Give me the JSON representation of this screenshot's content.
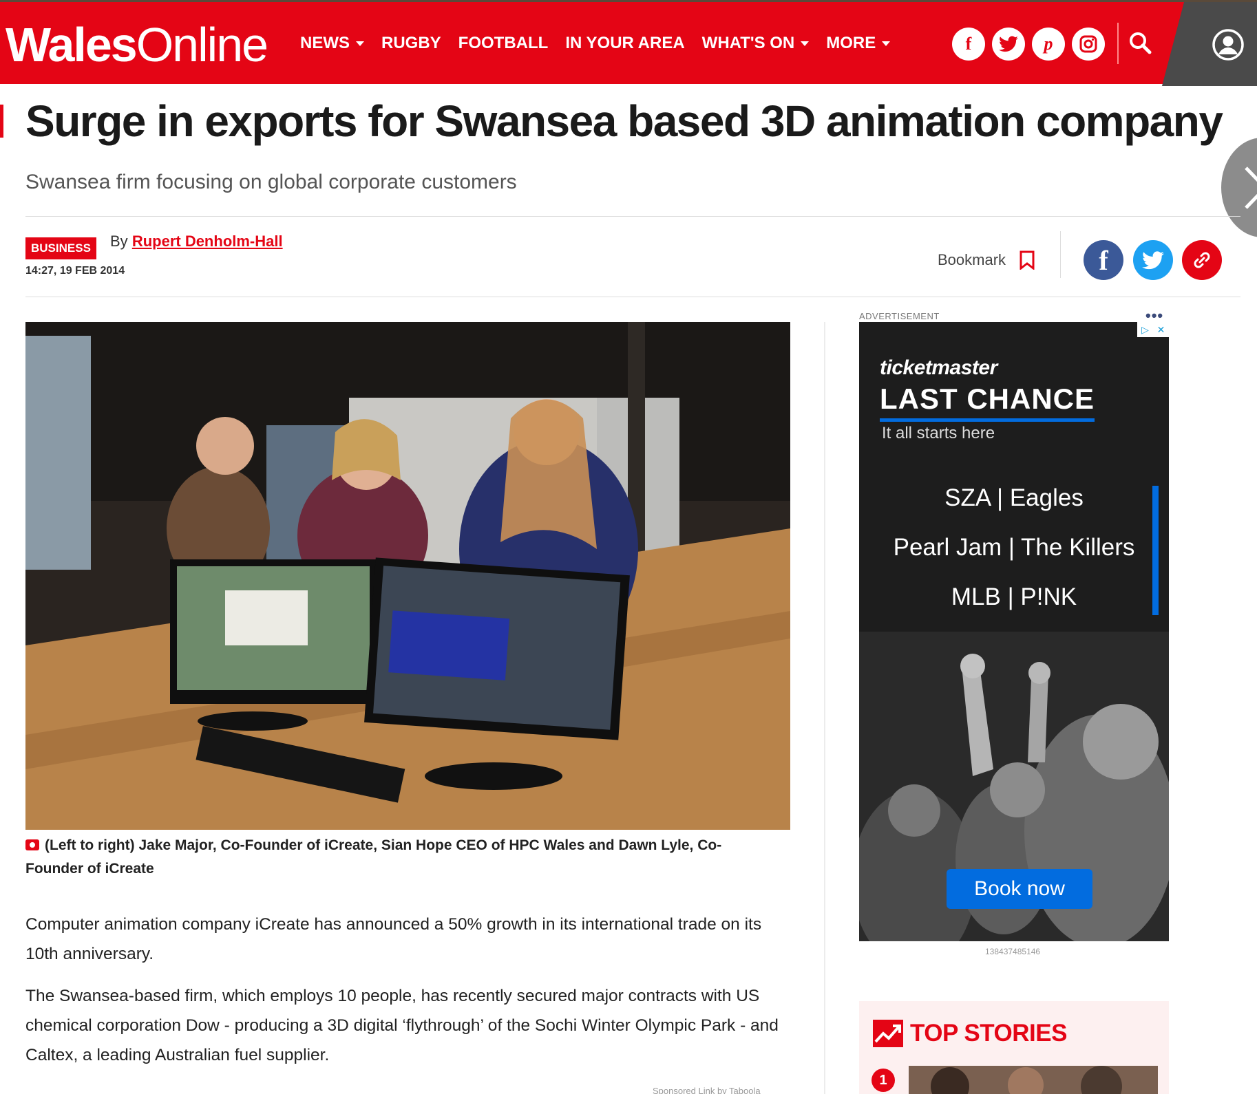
{
  "header": {
    "logo_bold": "Wales",
    "logo_light": "Online",
    "nav": [
      {
        "label": "NEWS",
        "dropdown": true
      },
      {
        "label": "RUGBY",
        "dropdown": false
      },
      {
        "label": "FOOTBALL",
        "dropdown": false
      },
      {
        "label": "IN YOUR AREA",
        "dropdown": false
      },
      {
        "label": "WHAT'S ON",
        "dropdown": true
      },
      {
        "label": "MORE",
        "dropdown": true
      }
    ],
    "social_icons": [
      "facebook-icon",
      "twitter-icon",
      "pinterest-icon",
      "instagram-icon"
    ],
    "brand_color": "#e40515"
  },
  "article": {
    "headline": "Surge in exports for Swansea based 3D animation company",
    "standfirst": "Swansea firm focusing on global corporate customers",
    "category": "BUSINESS",
    "by_prefix": "By",
    "author": "Rupert Denholm-Hall",
    "timestamp": "14:27, 19 FEB 2014",
    "bookmark_label": "Bookmark",
    "share_icons": [
      "facebook-share-icon",
      "twitter-share-icon",
      "copy-link-icon"
    ],
    "caption": "(Left to right) Jake Major, Co-Founder of iCreate, Sian Hope CEO of HPC Wales and Dawn Lyle, Co-Founder of iCreate",
    "paragraphs": [
      "Computer animation company iCreate has announced a 50% growth in its international trade on its 10th anniversary.",
      "The Swansea-based firm, which employs 10 people, has recently secured major contracts with US chemical corporation Dow - producing a 3D digital ‘flythrough’ of the Sochi Winter Olympic Park - and Caltex, a leading Australian fuel supplier."
    ],
    "sponsored": "Sponsored Link by Taboola"
  },
  "ad": {
    "label": "ADVERTISEMENT",
    "menu": "•••",
    "brand": "ticketmaster",
    "headline": "LAST CHANCE",
    "tagline": "It all starts here",
    "lines": [
      "SZA | Eagles",
      "Pearl Jam | The Killers",
      "MLB | P!NK"
    ],
    "cta": "Book now",
    "id": "138437485146",
    "accent_color": "#026cdf"
  },
  "top_stories": {
    "title": "TOP STORIES",
    "first_number": "1"
  }
}
